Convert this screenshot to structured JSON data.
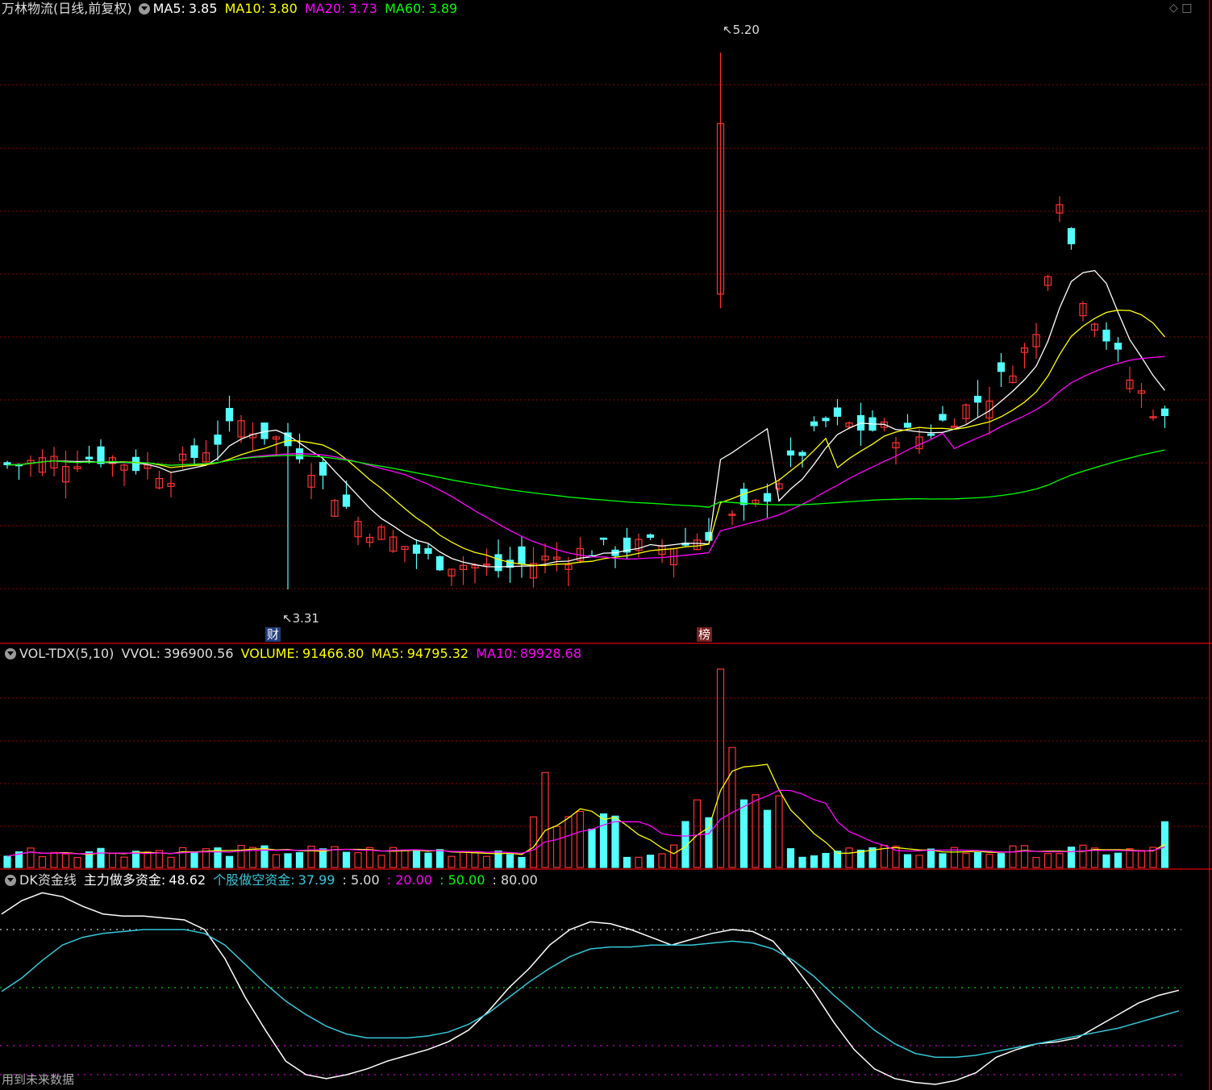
{
  "price_header": {
    "name": "万林物流(日线,前复权)",
    "ma5_label": "MA5:",
    "ma5": "3.85",
    "ma10_label": "MA10:",
    "ma10": "3.80",
    "ma20_label": "MA20:",
    "ma20": "3.73",
    "ma60_label": "MA60:",
    "ma60": "3.89"
  },
  "annotations": {
    "high": "5.20",
    "low": "3.31",
    "badge_cai": "财",
    "badge_bang": "榜"
  },
  "vol_header": {
    "name": "VOL-TDX(5,10)",
    "vvol_label": "VVOL:",
    "vvol": "396900.56",
    "volume_label": "VOLUME:",
    "volume": "91466.80",
    "ma5_label": "MA5:",
    "ma5": "94795.32",
    "ma10_label": "MA10:",
    "ma10": "89928.68"
  },
  "dk_header": {
    "name": "DK资金线",
    "main_label": "主力做多资金:",
    "main": "48.62",
    "short_label": "个股做空资金:",
    "short": "37.99",
    "lv1": ": 5.00",
    "lv2": ": 20.00",
    "lv3": ": 50.00",
    "lv4": ": 80.00"
  },
  "footer_note": "用到未来数据",
  "colors": {
    "up": "#ff3232",
    "down": "#54ffff",
    "ma5": "#ffffff",
    "ma10": "#ffff00",
    "ma20": "#ff00ff",
    "ma60": "#00ff00",
    "grid": "#8b0000"
  },
  "chart_data": [
    {
      "type": "candlestick",
      "title": "万林物流(日线,前复权)",
      "ylim": [
        3.2,
        5.3
      ],
      "high_marker": 5.2,
      "low_marker": 3.31,
      "ma_series": [
        {
          "name": "MA5",
          "last": 3.85
        },
        {
          "name": "MA10",
          "last": 3.8
        },
        {
          "name": "MA20",
          "last": 3.73
        },
        {
          "name": "MA60",
          "last": 3.89
        }
      ]
    },
    {
      "type": "bar",
      "title": "VOL-TDX(5,10)",
      "series": [
        {
          "name": "VOLUME",
          "last": 91466.8
        },
        {
          "name": "MA5",
          "last": 94795.32
        },
        {
          "name": "MA10",
          "last": 89928.68
        }
      ],
      "peak_volume": 396900.56
    },
    {
      "type": "line",
      "title": "DK资金线",
      "levels": [
        5,
        20,
        50,
        80
      ],
      "series": [
        {
          "name": "主力做多资金",
          "last": 48.62,
          "values": [
            88,
            95,
            99,
            97,
            92,
            88,
            87,
            87,
            86,
            85,
            80,
            65,
            45,
            28,
            12,
            5,
            3,
            5,
            8,
            12,
            15,
            18,
            22,
            28,
            38,
            50,
            60,
            72,
            80,
            84,
            83,
            80,
            76,
            72,
            75,
            78,
            80,
            79,
            74,
            62,
            48,
            32,
            18,
            8,
            3,
            1,
            0,
            2,
            6,
            14,
            18,
            21,
            22,
            24,
            30,
            36,
            42,
            46,
            48.62
          ]
        },
        {
          "name": "个股做空资金",
          "last": 37.99,
          "values": [
            48,
            55,
            64,
            72,
            76,
            78,
            79,
            80,
            80,
            80,
            78,
            72,
            62,
            52,
            43,
            36,
            30,
            26,
            24,
            24,
            24,
            25,
            27,
            31,
            37,
            45,
            53,
            60,
            66,
            70,
            71,
            71,
            72,
            72,
            72,
            73,
            74,
            73,
            70,
            64,
            56,
            46,
            37,
            28,
            21,
            16,
            14,
            14,
            15,
            17,
            19,
            21,
            23,
            25,
            27,
            29,
            32,
            35,
            37.99
          ]
        }
      ]
    }
  ]
}
